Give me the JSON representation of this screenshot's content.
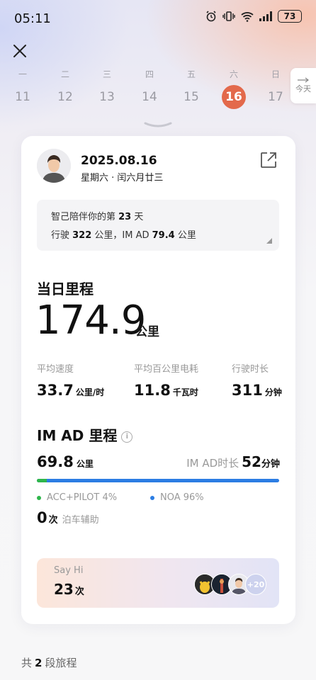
{
  "status_bar": {
    "time": "05:11",
    "battery": "73"
  },
  "week": {
    "days": [
      {
        "weekday": "一",
        "date": "11"
      },
      {
        "weekday": "二",
        "date": "12"
      },
      {
        "weekday": "三",
        "date": "13"
      },
      {
        "weekday": "四",
        "date": "14"
      },
      {
        "weekday": "五",
        "date": "15"
      },
      {
        "weekday": "六",
        "date": "16"
      },
      {
        "weekday": "日",
        "date": "17"
      }
    ],
    "selected_index": 5,
    "today_label": "今天"
  },
  "card": {
    "date": "2025.08.16",
    "lunar": "星期六 · 闰六月廿三",
    "companion": {
      "prefix": "智己陪伴你的第 ",
      "days": "23",
      "suffix": " 天"
    },
    "drive_summary": {
      "prefix": "行驶 ",
      "km": "322",
      "mid": " 公里，IM AD ",
      "imad_km": "79.4",
      "suffix": " 公里"
    },
    "daily_mileage": {
      "title": "当日里程",
      "value": "174.9",
      "unit": "公里"
    },
    "stats": [
      {
        "label": "平均速度",
        "value": "33.7",
        "unit": "公里/时"
      },
      {
        "label": "平均百公里电耗",
        "value": "11.8",
        "unit": "千瓦时"
      },
      {
        "label": "行驶时长",
        "value": "311",
        "unit": "分钟"
      }
    ],
    "imad": {
      "title": "IM AD 里程",
      "distance": "69.8",
      "distance_unit": "公里",
      "duration_label": "IM AD时长",
      "duration": "52",
      "duration_unit": "分钟",
      "acc_fraction": 0.04,
      "legend": [
        {
          "label": "ACC+PILOT 4%",
          "color": "#2fb64b"
        },
        {
          "label": "NOA 96%",
          "color": "#2c7de3"
        }
      ],
      "parking": {
        "count": "0",
        "unit": "次",
        "label": "泊车辅助"
      }
    },
    "say_hi": {
      "title": "Say Hi",
      "count": "23",
      "unit": "次",
      "more": "+20"
    }
  },
  "trips": {
    "prefix": "共",
    "count": "2",
    "suffix": "段旅程"
  }
}
